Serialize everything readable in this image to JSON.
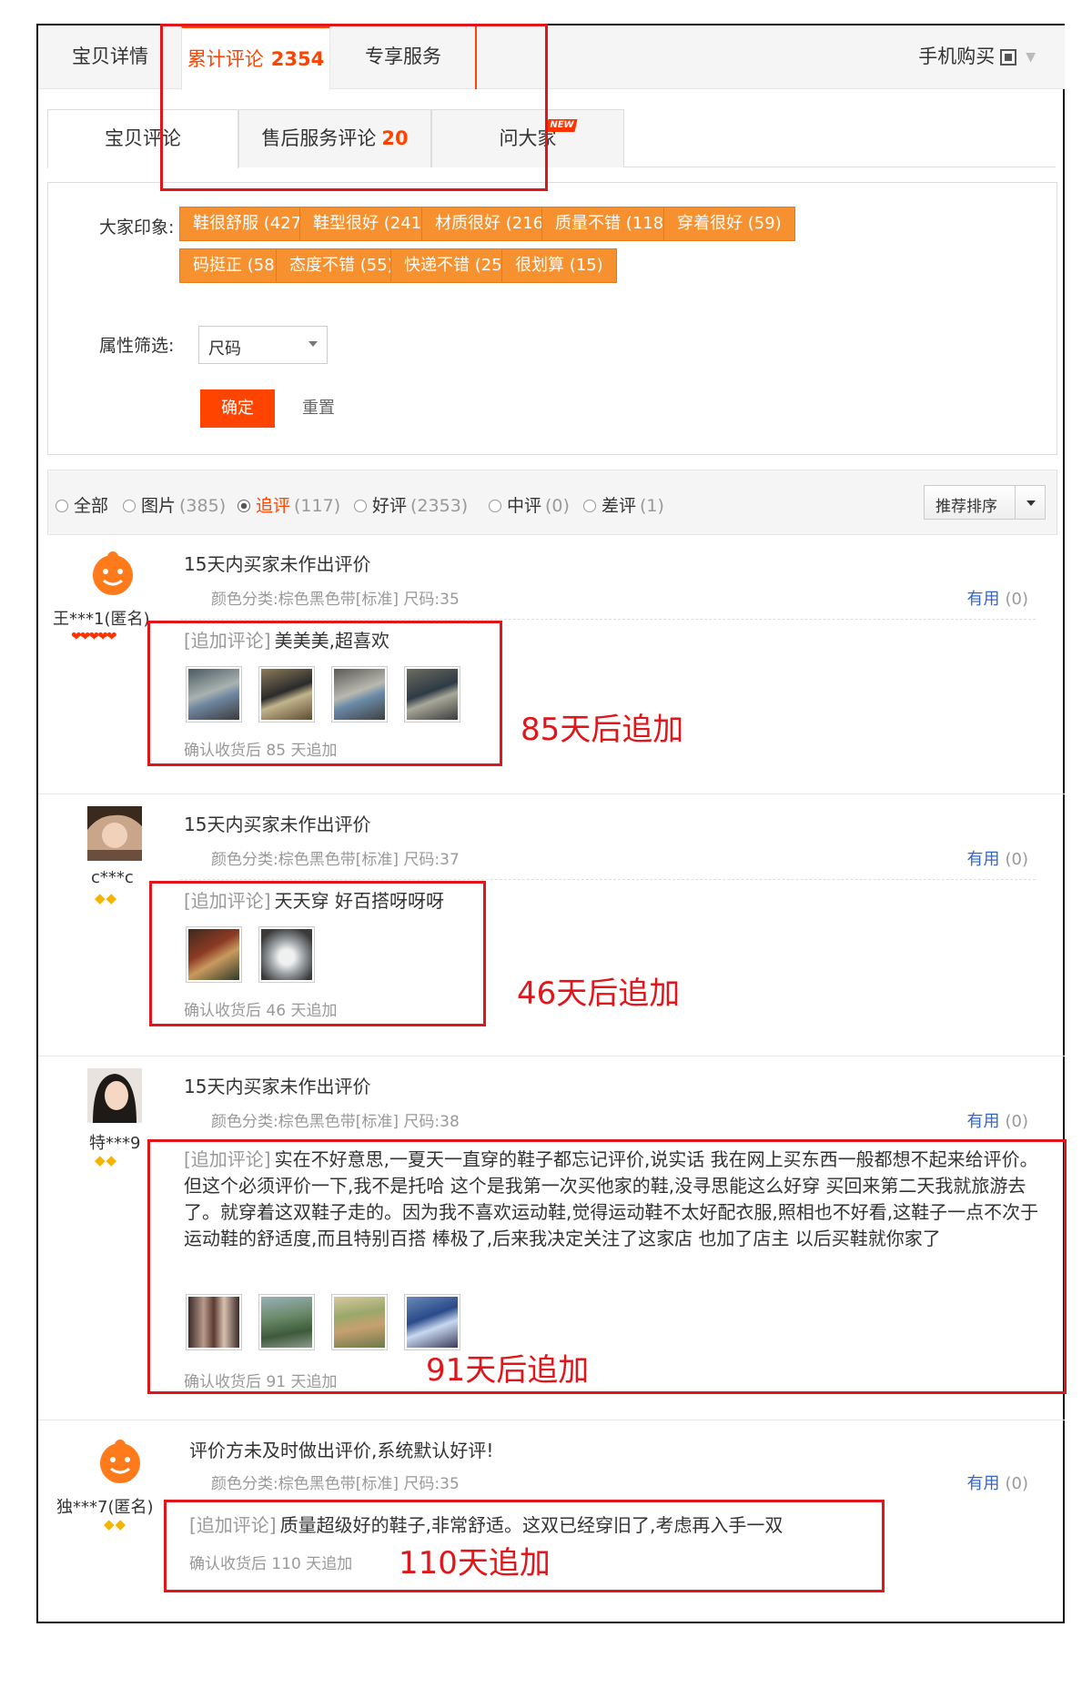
{
  "tabs": {
    "details": "宝贝详情",
    "reviews_label": "累计评论",
    "reviews_count": "2354",
    "service": "专享服务",
    "mobile": "手机购买"
  },
  "subtabs": {
    "item_reviews": "宝贝评论",
    "after_sales_label": "售后服务评论",
    "after_sales_count": "20",
    "ask": "问大家",
    "new_badge": "NEW"
  },
  "impressions": {
    "label": "大家印象:",
    "tags": [
      "鞋很舒服 (427)",
      "鞋型很好 (241)",
      "材质很好 (216)",
      "质量不错 (118)",
      "穿着很好 (59)",
      "码挺正 (58)",
      "态度不错 (55)",
      "快递不错 (25)",
      "很划算 (15)"
    ]
  },
  "attr_filter": {
    "label": "属性筛选:",
    "selected": "尺码",
    "confirm": "确定",
    "reset": "重置"
  },
  "filter_row": {
    "options": [
      {
        "label": "全部",
        "count": ""
      },
      {
        "label": "图片",
        "count": "(385)"
      },
      {
        "label": "追评",
        "count": "(117)"
      },
      {
        "label": "好评",
        "count": "(2353)"
      },
      {
        "label": "中评",
        "count": "(0)"
      },
      {
        "label": "差评",
        "count": "(1)"
      }
    ],
    "sort": "推荐排序"
  },
  "reviews": [
    {
      "user": "王***1(匿名)",
      "title": "15天内买家未作出评价",
      "meta": "颜色分类:棕色黑色带[标准]  尺码:35",
      "useful": "有用",
      "useful_count": "(0)",
      "append_prefix": "[追加评论]",
      "append_text": "美美美,超喜欢",
      "append_time": "确认收货后 85 天追加",
      "annotation": "85天后追加"
    },
    {
      "user": "c***c",
      "title": "15天内买家未作出评价",
      "meta": "颜色分类:棕色黑色带[标准]  尺码:37",
      "useful": "有用",
      "useful_count": "(0)",
      "append_prefix": "[追加评论]",
      "append_text": "天天穿 好百搭呀呀呀",
      "append_time": "确认收货后 46 天追加",
      "annotation": "46天后追加"
    },
    {
      "user": "特***9",
      "title": "15天内买家未作出评价",
      "meta": "颜色分类:棕色黑色带[标准]  尺码:38",
      "useful": "有用",
      "useful_count": "(0)",
      "append_prefix": "[追加评论]",
      "append_text": "实在不好意思,一夏天一直穿的鞋子都忘记评价,说实话 我在网上买东西一般都想不起来给评价。但这个必须评价一下,我不是托哈 这个是我第一次买他家的鞋,没寻思能这么好穿 买回来第二天我就旅游去了。就穿着这双鞋子走的。因为我不喜欢运动鞋,觉得运动鞋不太好配衣服,照相也不好看,这鞋子一点不次于运动鞋的舒适度,而且特别百搭 棒极了,后来我决定关注了这家店 也加了店主    以后买鞋就你家了",
      "append_time": "确认收货后 91 天追加",
      "annotation": "91天后追加"
    },
    {
      "user": "独***7(匿名)",
      "title": "评价方未及时做出评价,系统默认好评!",
      "meta": "颜色分类:棕色黑色带[标准]  尺码:35",
      "useful": "有用",
      "useful_count": "(0)",
      "append_prefix": "[追加评论]",
      "append_text": "质量超级好的鞋子,非常舒适。这双已经穿旧了,考虑再入手一双",
      "append_time": "确认收货后 110 天追加",
      "annotation": "110天追加"
    }
  ],
  "colors": {
    "accent": "#ff4400",
    "tag_bg": "#f7902f",
    "annotation_red": "#e0161b",
    "link_blue": "#3366cc"
  }
}
